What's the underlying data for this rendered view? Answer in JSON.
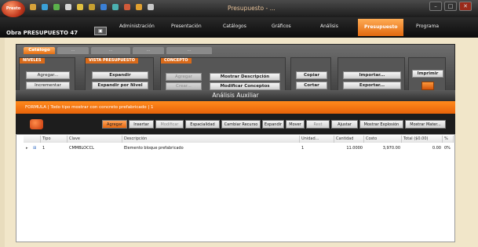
{
  "window": {
    "orb_label": "Presto",
    "title": "Presupuesto - ...",
    "minimize_glyph": "–",
    "maximize_glyph": "□",
    "close_glyph": "✕"
  },
  "quick_access": [
    "#d6a23a",
    "#3aa0d6",
    "#5bb14b",
    "#d6d6d6",
    "#e0c040",
    "#c7a030",
    "#3a7fd6",
    "#4bb0b0",
    "#d05a3a",
    "#e0a030",
    "#c8c8c8"
  ],
  "document": {
    "label": "Obra PRESUPUESTO 47",
    "button_glyph": "▣"
  },
  "menu": {
    "items": [
      "Administración",
      "Presentación",
      "Catálogos",
      "Gráficos",
      "Análisis",
      "Presupuesto",
      "Programa"
    ]
  },
  "ribbon": {
    "tabs": [
      "Catálogo",
      "...",
      "...",
      "...",
      "..."
    ],
    "groups": {
      "niveles": {
        "title": "NIVELES",
        "buttons": [
          "Agregar...",
          "Incrementar"
        ]
      },
      "vista": {
        "title": "VISTA PRESUPUESTO",
        "buttons": [
          "Expandir",
          "Expandir por Nivel"
        ]
      },
      "concepto": {
        "title": "CONCEPTO",
        "buttons": [
          "Agregar",
          "Crear...",
          "Mostrar Descripción",
          "Modificar Conceptos"
        ]
      },
      "portapapeles": {
        "buttons": [
          "Copiar",
          "Cortar"
        ]
      },
      "datos": {
        "buttons": [
          "Importar...",
          "Exportar..."
        ]
      },
      "imprimir": {
        "label": "Imprimir"
      }
    }
  },
  "dialog": {
    "title": "Análisis Auxiliar",
    "info": "FORMULA  |  Todo tipo mostrar con concreto prefabricado  |  1"
  },
  "toolbar": {
    "buttons": [
      "Agregar",
      "Insertar",
      "Modificar",
      "Espacialidad",
      "Cambiar Recurso",
      "Expandir",
      "Mover",
      "Rest",
      "Ajustar",
      "Mostrar Explosión",
      "Mostrar Mater..."
    ]
  },
  "grid": {
    "columns": [
      "",
      "Tipo",
      "Clave",
      "Descripción",
      "Unidad...",
      "Cantidad",
      "Costo",
      "Total ($0.00)",
      "%"
    ],
    "rows": [
      {
        "marker": "▸",
        "expand": "⊞",
        "tipo": "1",
        "clave": "CMMBLOCCL",
        "descripcion": "Elemento bloque prefabricado",
        "unidad": "1",
        "cantidad": "11.0000",
        "costo": "3,970.00",
        "total": "0.00",
        "pct": "0%"
      }
    ]
  }
}
